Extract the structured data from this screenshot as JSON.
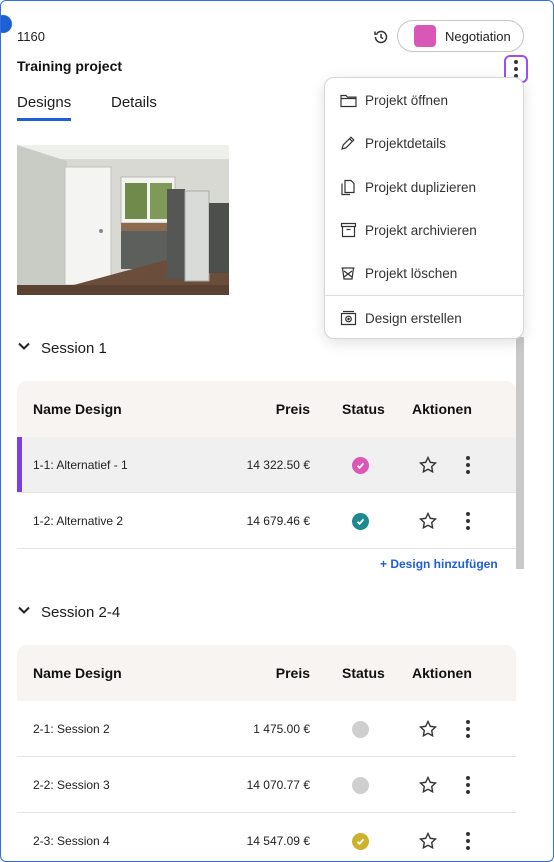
{
  "header": {
    "project_id": "1160",
    "project_title": "Training project",
    "status_label": "Negotiation",
    "status_color": "#d957b7"
  },
  "tabs": [
    {
      "label": "Designs",
      "active": true
    },
    {
      "label": "Details",
      "active": false
    }
  ],
  "menu": {
    "items": [
      {
        "label": "Projekt öffnen",
        "icon": "folder-icon"
      },
      {
        "label": "Projektdetails",
        "icon": "pen-icon"
      },
      {
        "label": "Projekt duplizieren",
        "icon": "duplicate-icon"
      },
      {
        "label": "Projekt archivieren",
        "icon": "archive-icon"
      },
      {
        "label": "Projekt löschen",
        "icon": "trash-icon"
      },
      {
        "label": "Design erstellen",
        "icon": "create-design-icon"
      }
    ]
  },
  "table_headers": {
    "name": "Name Design",
    "price": "Preis",
    "status": "Status",
    "actions": "Aktionen"
  },
  "sessions": [
    {
      "title": "Session 1",
      "designs": [
        {
          "name": "1-1: Alternatief - 1",
          "price": "14 322.50 €",
          "status": "check",
          "status_color": "#d957b7",
          "selected": true
        },
        {
          "name": "1-2: Alternative 2",
          "price": "14 679.46 €",
          "status": "check",
          "status_color": "#1e8a8f",
          "selected": false
        }
      ],
      "add_label": "+ Design hinzufügen"
    },
    {
      "title": "Session 2-4",
      "designs": [
        {
          "name": "2-1: Session 2",
          "price": "1 475.00 €",
          "status": "empty",
          "status_color": "#cfcfcf"
        },
        {
          "name": "2-2: Session 3",
          "price": "14 070.77 €",
          "status": "empty",
          "status_color": "#cfcfcf"
        },
        {
          "name": "2-3: Session 4",
          "price": "14 547.09 €",
          "status": "check",
          "status_color": "#cbb22a"
        }
      ]
    }
  ],
  "colors": {
    "accent_blue": "#1f5fd6",
    "selection_purple": "#7b3fe4",
    "header_bg": "#f7f4f1"
  }
}
